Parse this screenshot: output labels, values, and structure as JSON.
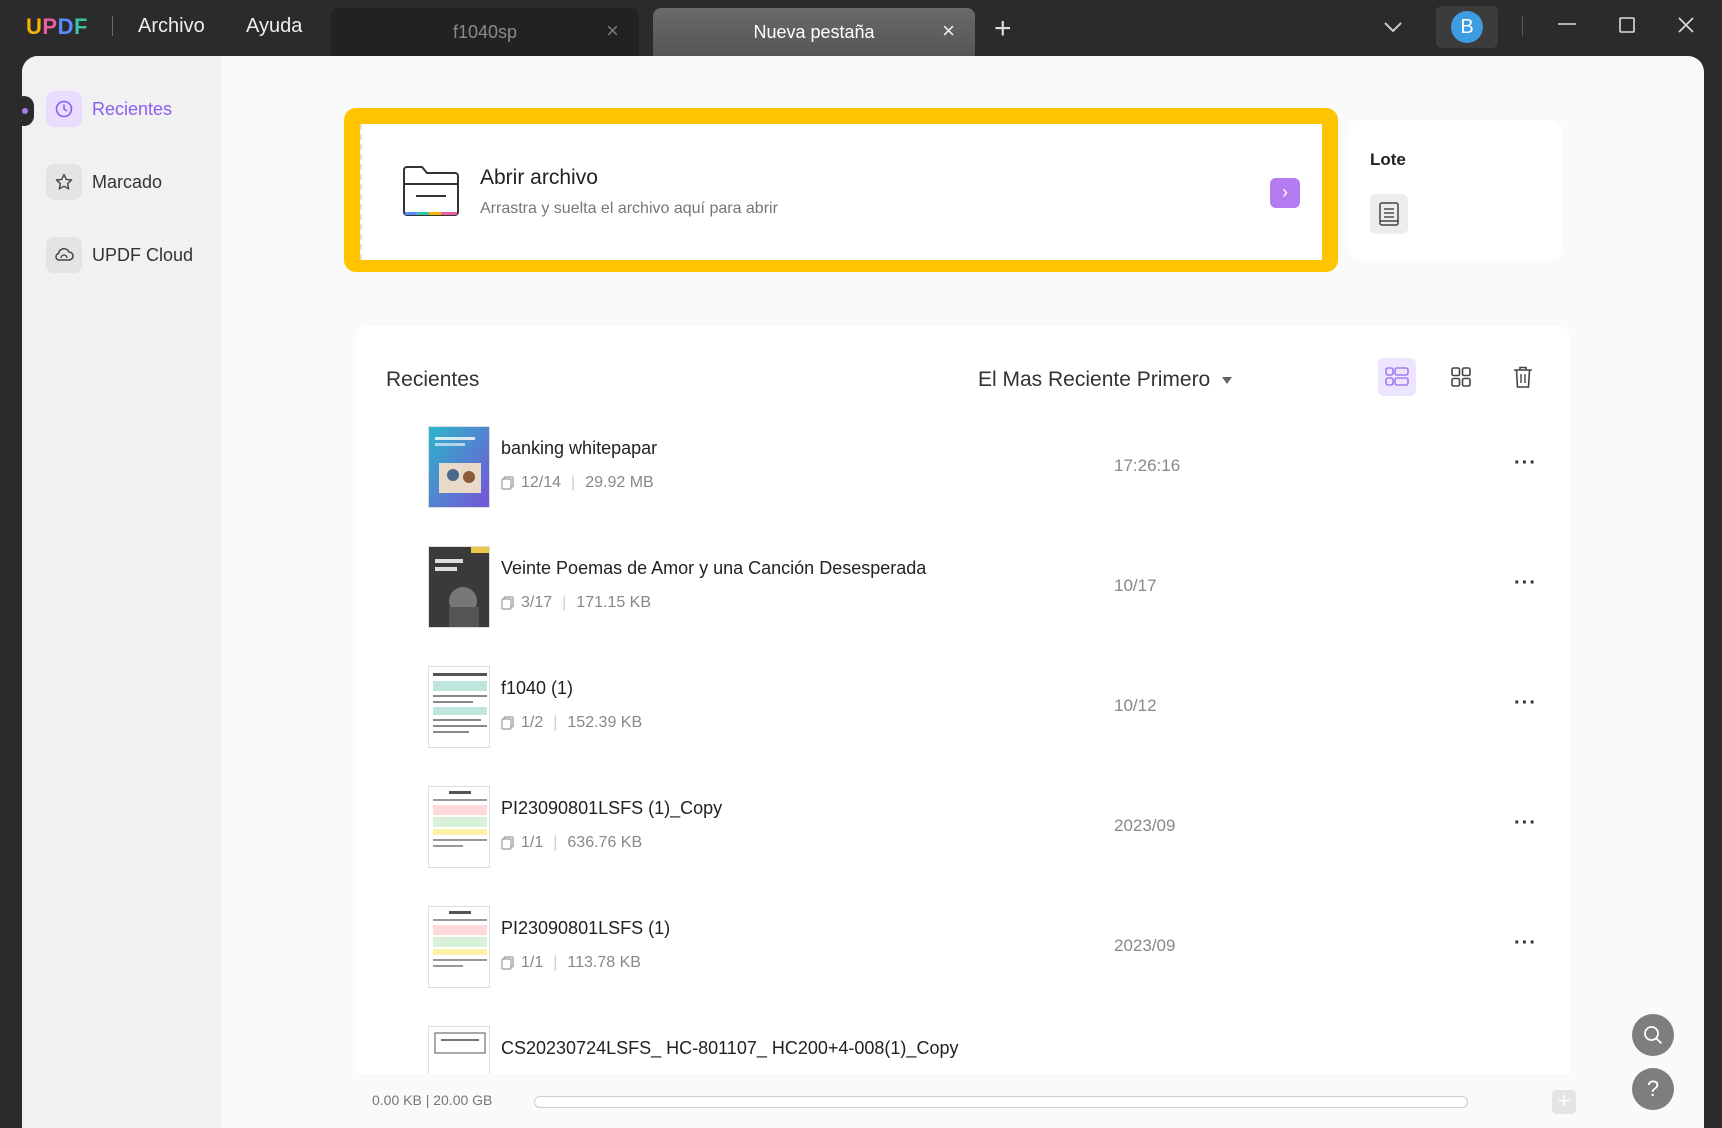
{
  "titlebar": {
    "logo": [
      "U",
      "P",
      "D",
      "F"
    ],
    "menu": [
      "Archivo",
      "Ayuda"
    ],
    "tabs": [
      {
        "label": "f1040sp",
        "active": false
      },
      {
        "label": "Nueva pestaña",
        "active": true
      }
    ],
    "avatar_initial": "B"
  },
  "sidebar": {
    "items": [
      {
        "label": "Recientes",
        "icon": "clock-icon",
        "active": true
      },
      {
        "label": "Marcado",
        "icon": "star-icon",
        "active": false
      },
      {
        "label": "UPDF Cloud",
        "icon": "cloud-icon",
        "active": false
      }
    ]
  },
  "open_file": {
    "title": "Abrir archivo",
    "subtitle": "Arrastra y suelta el archivo aquí para abrir",
    "arrow": "›"
  },
  "batch": {
    "title": "Lote"
  },
  "recents": {
    "title": "Recientes",
    "sort_label": "El Mas Reciente Primero",
    "files": [
      {
        "name": "banking whitepapar",
        "pages": "12/14",
        "size": "29.92 MB",
        "time": "17:26:16"
      },
      {
        "name": "Veinte Poemas de Amor y una Canción Desesperada",
        "pages": "3/17",
        "size": "171.15 KB",
        "time": "10/17"
      },
      {
        "name": "f1040 (1)",
        "pages": "1/2",
        "size": "152.39 KB",
        "time": "10/12"
      },
      {
        "name": "PI23090801LSFS (1)_Copy",
        "pages": "1/1",
        "size": "636.76 KB",
        "time": "2023/09"
      },
      {
        "name": "PI23090801LSFS (1)",
        "pages": "1/1",
        "size": "113.78 KB",
        "time": "2023/09"
      },
      {
        "name": "CS20230724LSFS_ HC-801107_ HC200+4-008(1)_Copy",
        "pages": "",
        "size": "",
        "time": ""
      }
    ],
    "more": "···"
  },
  "footer": {
    "storage": "0.00 KB | 20.00 GB",
    "usage_fraction": 0
  },
  "fab": {
    "help": "?"
  },
  "colors": {
    "accent": "#b57cf2",
    "highlight": "#ffc400",
    "avatar": "#3d9de0"
  }
}
